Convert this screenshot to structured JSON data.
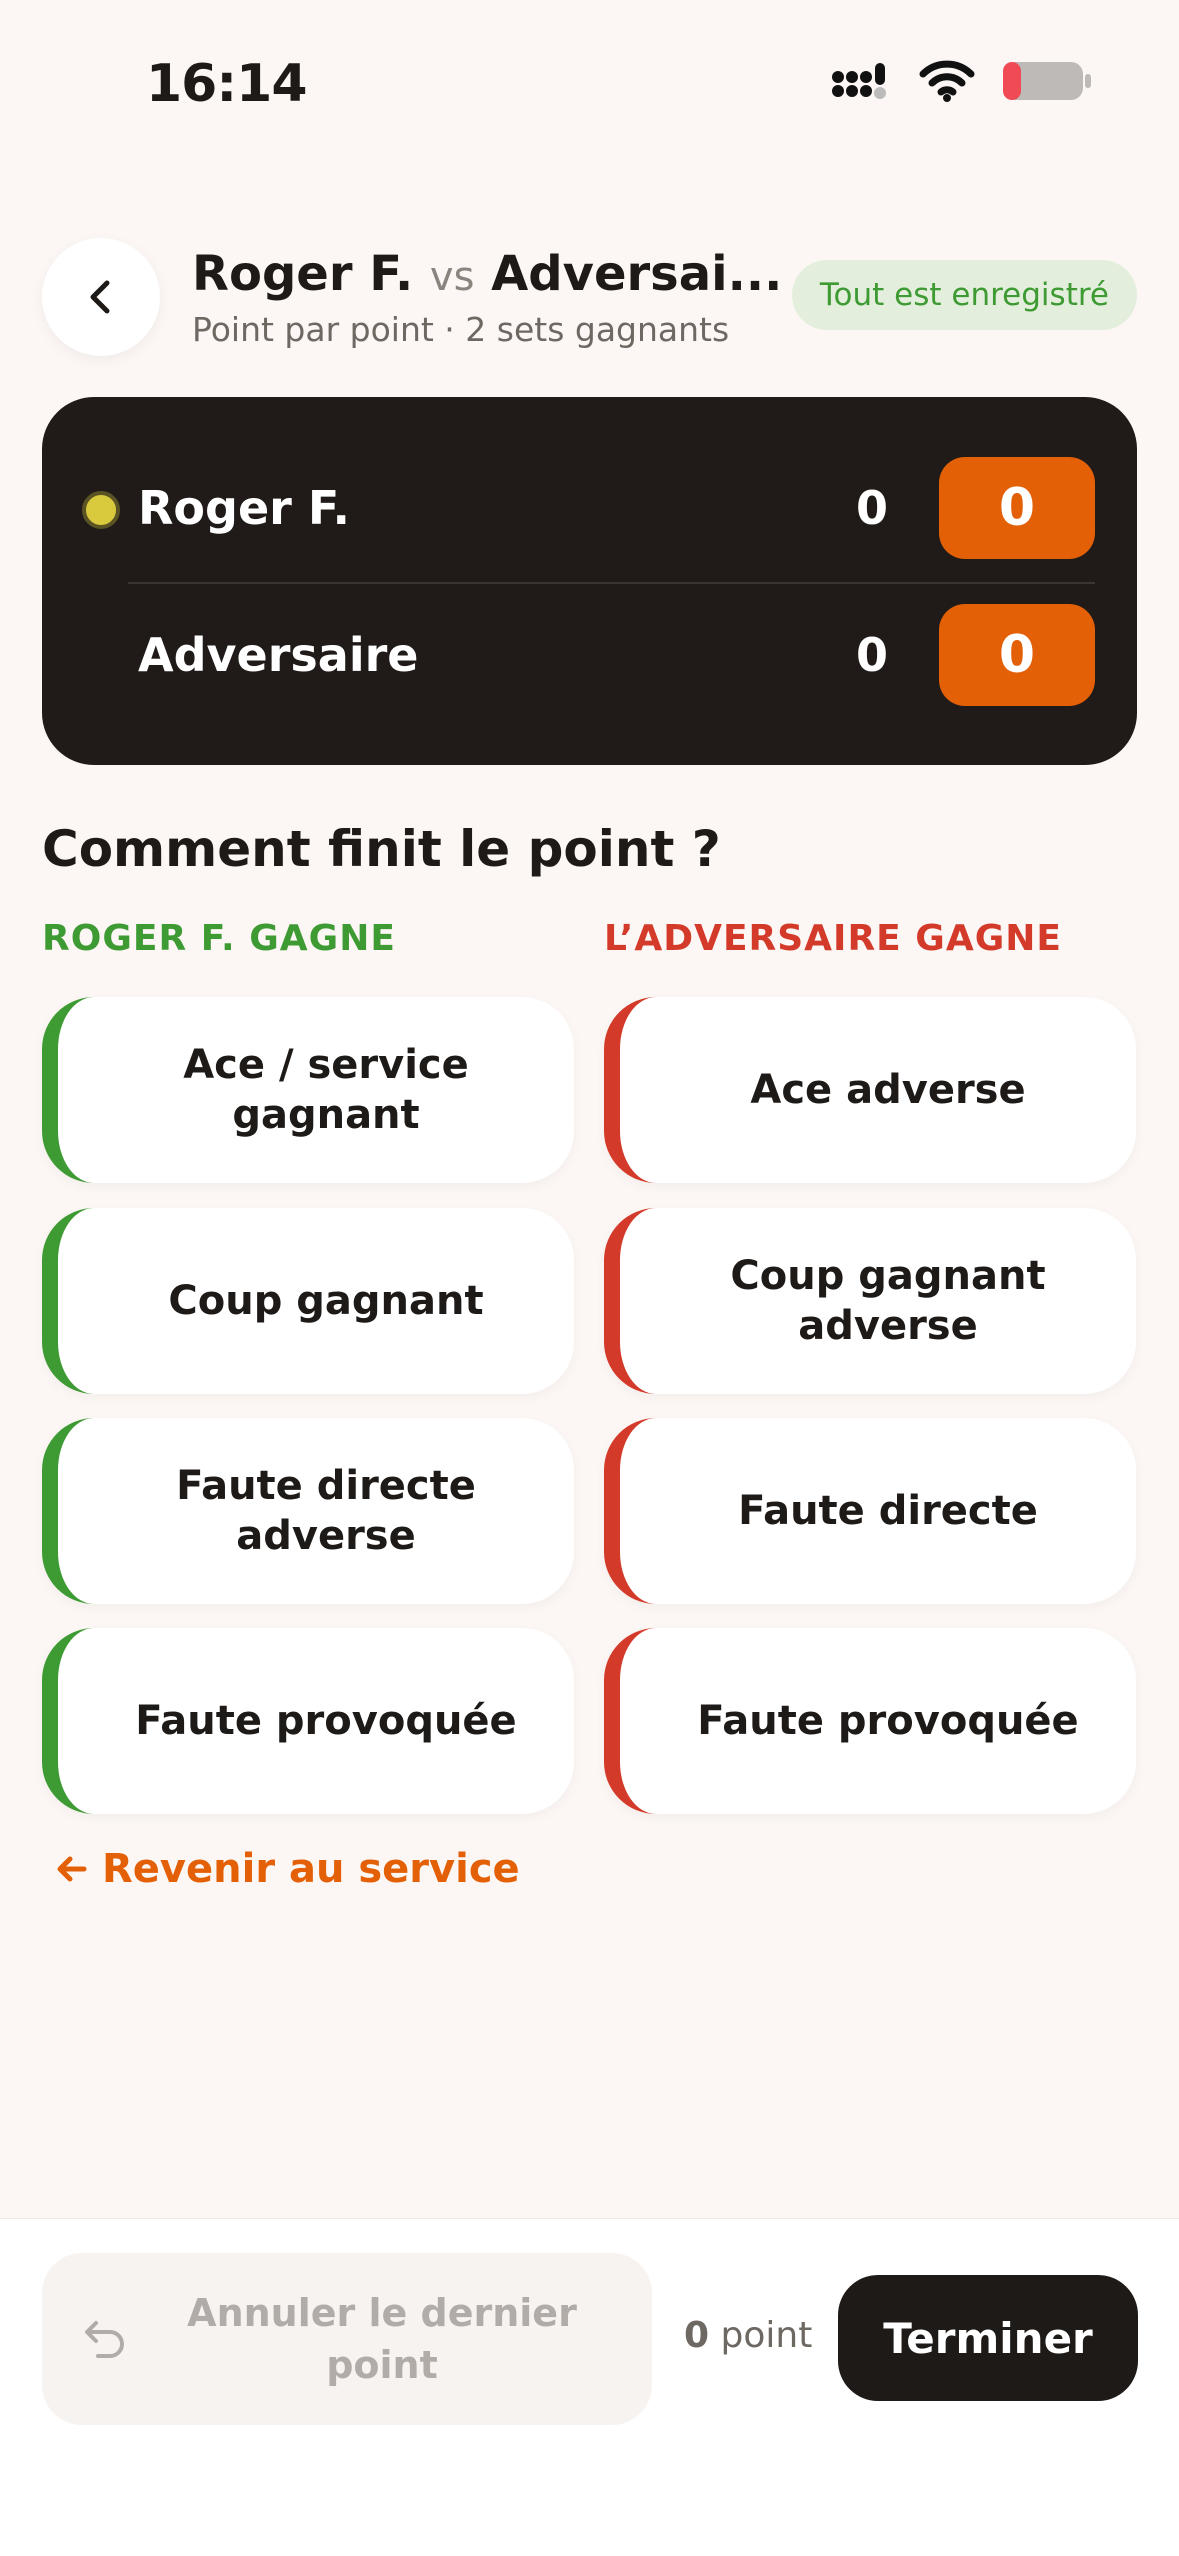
{
  "status_bar": {
    "time": "16:14",
    "icons": [
      "cellular-icon",
      "wifi-icon",
      "battery-icon"
    ],
    "battery_color": "#F04B55"
  },
  "header": {
    "player": "Roger F.",
    "vs": "vs",
    "opponent": "Adversai...",
    "subtitle": "Point par point · 2 sets gagnants",
    "saved_badge": "Tout est enregistré"
  },
  "scoreboard": {
    "rows": [
      {
        "name": "Roger F.",
        "sets": "0",
        "games": "0",
        "serving": true
      },
      {
        "name": "Adversaire",
        "sets": "0",
        "games": "0",
        "serving": false
      }
    ]
  },
  "question": "Comment finit le point ?",
  "columns": {
    "win_title": "ROGER F. GAGNE",
    "lose_title": "L’ADVERSAIRE GAGNE",
    "win_actions": [
      "Ace / service gagnant",
      "Coup gagnant",
      "Faute directe adverse",
      "Faute provoquée"
    ],
    "lose_actions": [
      "Ace adverse",
      "Coup gagnant adverse",
      "Faute directe",
      "Faute provoquée"
    ]
  },
  "back_to_service": "Revenir au service",
  "footer": {
    "undo_label": "Annuler le dernier point",
    "points_count": "0",
    "points_unit": "point",
    "finish_label": "Terminer"
  },
  "colors": {
    "accent_orange": "#E36007",
    "win_green": "#3E9A33",
    "lose_red": "#D43A2A",
    "scoreboard_bg": "#201B19",
    "page_bg": "#FCF7F4"
  }
}
